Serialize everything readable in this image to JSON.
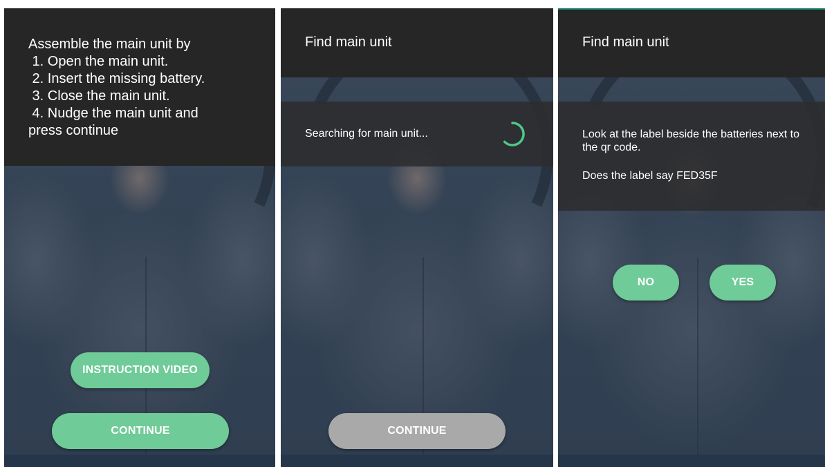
{
  "screens": {
    "assemble": {
      "instructions": [
        "Assemble the main unit by",
        " 1. Open the main unit.",
        " 2. Insert the missing battery.",
        " 3. Close the main unit.",
        " 4. Nudge the main unit and",
        "press continue"
      ],
      "video_button_label": "INSTRUCTION VIDEO",
      "continue_button_label": "CONTINUE"
    },
    "searching": {
      "title": "Find main unit",
      "status_text": "Searching for main unit...",
      "continue_button_label": "CONTINUE"
    },
    "confirm": {
      "title": "Find main unit",
      "instruction_text": "Look at the label beside the batteries next to the qr code.",
      "question_text": "Does the label say FED35F",
      "no_button_label": "NO",
      "yes_button_label": "YES"
    }
  },
  "colors": {
    "accent_green": "#6fcb97",
    "disabled_gray": "#a9a9a9",
    "panel_dark": "#262626",
    "spinner_green": "#4fc98a"
  },
  "icons": {
    "spinner": "loading-spinner-icon"
  }
}
